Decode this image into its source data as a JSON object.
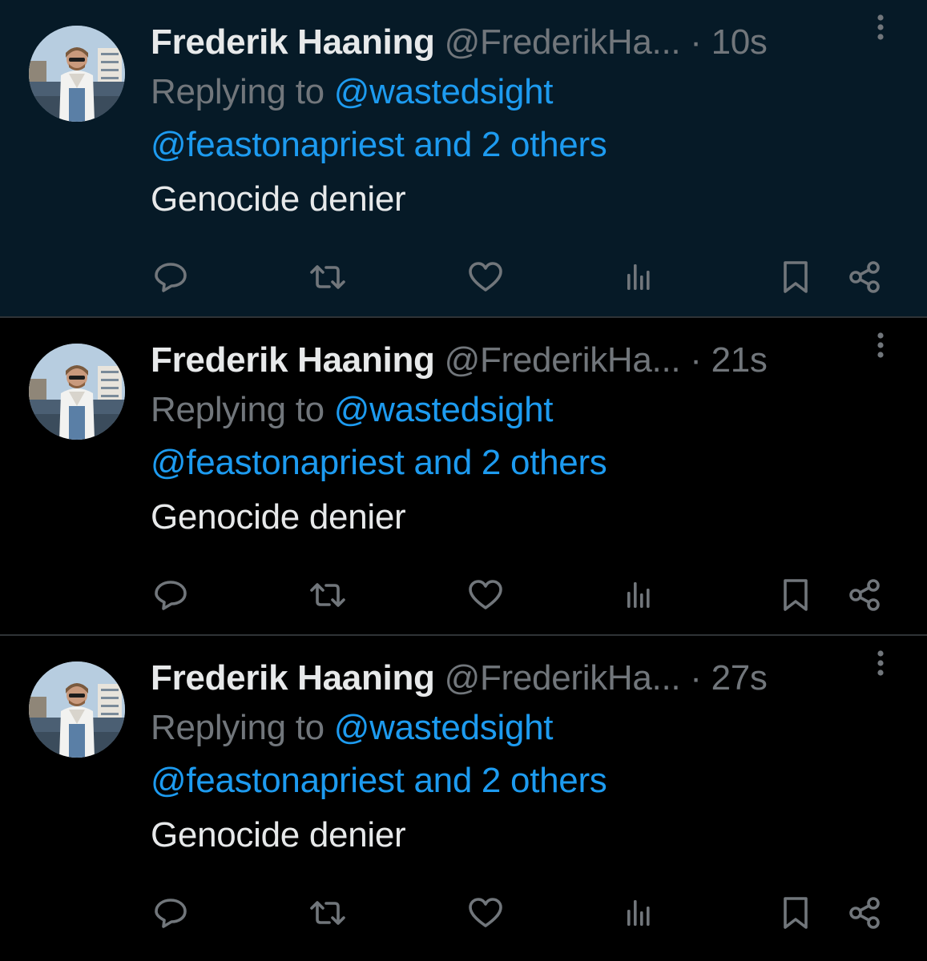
{
  "colors": {
    "background": "#000000",
    "highlight_background": "#061a27",
    "primary_text": "#e7e9ea",
    "secondary_text": "#71767b",
    "link": "#1d9bf0",
    "divider": "#2f3336"
  },
  "icons": {
    "reply": "reply-icon",
    "repost": "repost-icon",
    "like": "like-icon",
    "views": "views-icon",
    "bookmark": "bookmark-icon",
    "share": "share-icon",
    "more": "more-icon"
  },
  "tweets": [
    {
      "name": "Frederik Haaning",
      "handle": "@FrederikHa...",
      "separator": "·",
      "time": "10s",
      "replying_prefix": "Replying to",
      "reply_to_first": "@wastedsight",
      "reply_to_rest": "@feastonapriest and 2 others",
      "text": "Genocide denier"
    },
    {
      "name": "Frederik Haaning",
      "handle": "@FrederikHa...",
      "separator": "·",
      "time": "21s",
      "replying_prefix": "Replying to",
      "reply_to_first": "@wastedsight",
      "reply_to_rest": "@feastonapriest and 2 others",
      "text": "Genocide denier"
    },
    {
      "name": "Frederik Haaning",
      "handle": "@FrederikHa...",
      "separator": "·",
      "time": "27s",
      "replying_prefix": "Replying to",
      "reply_to_first": "@wastedsight",
      "reply_to_rest": "@feastonapriest and 2 others",
      "text": "Genocide denier"
    }
  ]
}
